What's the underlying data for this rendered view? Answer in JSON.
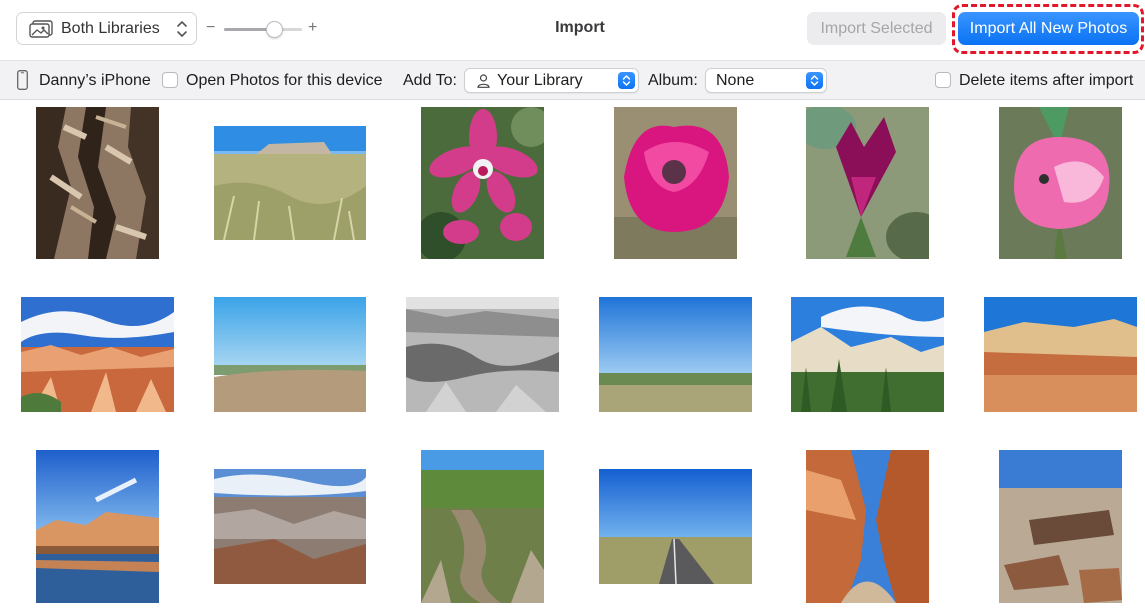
{
  "toolbar": {
    "library_selector": "Both Libraries",
    "zoom_minus": "−",
    "zoom_plus": "+",
    "zoom_level": 0.65,
    "title": "Import",
    "import_selected_label": "Import Selected",
    "import_all_label": "Import All New Photos"
  },
  "device_bar": {
    "device_name": "Danny’s iPhone",
    "open_photos_label": "Open Photos for this device",
    "open_photos_checked": false,
    "add_to_label": "Add To:",
    "add_to_value": "Your Library",
    "album_label": "Album:",
    "album_value": "None",
    "delete_label": "Delete items after import",
    "delete_checked": false
  },
  "colors": {
    "accent": "#0a72f3",
    "highlight": "#e2182a",
    "disabled_text": "#a5a5aa",
    "devicebar_bg": "#f2f2f4"
  },
  "photos": [
    {
      "subject": "tree-bark"
    },
    {
      "subject": "grassland-mesa"
    },
    {
      "subject": "pink-orchids"
    },
    {
      "subject": "magenta-tulip"
    },
    {
      "subject": "purple-tulip"
    },
    {
      "subject": "pink-tulip"
    },
    {
      "subject": "bryce-canyon"
    },
    {
      "subject": "blue-sky-plain"
    },
    {
      "subject": "badlands-bw"
    },
    {
      "subject": "flat-horizon"
    },
    {
      "subject": "zion-mesas"
    },
    {
      "subject": "red-cliffs"
    },
    {
      "subject": "lake-cliffs"
    },
    {
      "subject": "grand-canyon"
    },
    {
      "subject": "creek-wash"
    },
    {
      "subject": "open-road"
    },
    {
      "subject": "slot-canyon"
    },
    {
      "subject": "petrified-wood"
    }
  ]
}
